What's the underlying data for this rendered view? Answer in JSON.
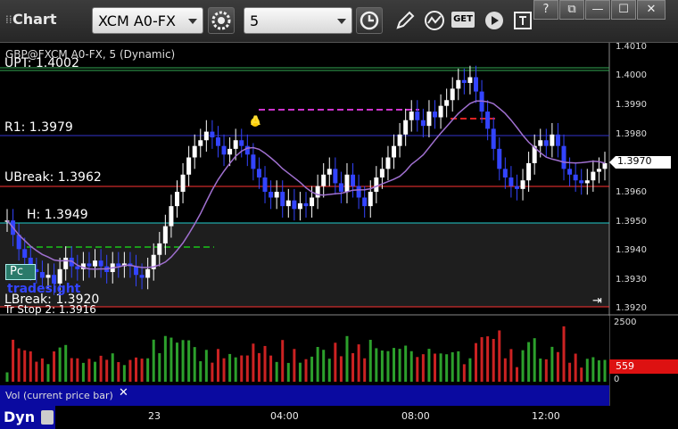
{
  "window": {
    "title": "Chart",
    "controls": [
      "?",
      "⧉",
      "—",
      "☐",
      "✕"
    ]
  },
  "toolbar": {
    "symbol": "XCM A0-FX",
    "interval": "5",
    "get_label": "GET"
  },
  "chart": {
    "instrument_label": "GBP@FXCM A0-FX, 5 (Dynamic)",
    "current_price": "1.3970",
    "current_volume": "559",
    "levels": {
      "upt": "UPT: 1.4002",
      "r1": "R1: 1.3979",
      "ubreak": "UBreak: 1.3962",
      "pivot": "H: 1.3949",
      "lbreak": "LBreak: 1.3920",
      "tr_stop": "Tr Stop 2: 1.3916"
    },
    "price_ticks": [
      "1.4010",
      "1.4000",
      "1.3990",
      "1.3980",
      "1.3960",
      "1.3950",
      "1.3940",
      "1.3930",
      "1.3920"
    ],
    "volume_ticks": [
      "2500",
      "0"
    ],
    "time_ticks": [
      "23",
      "04:00",
      "08:00",
      "12:00"
    ],
    "volume_panel_label": "Vol (current price bar)",
    "close_x": "✕",
    "dyn_label": "Dyn",
    "pc_badge": "Pc",
    "watermark": "tradesight",
    "marker_a": "A",
    "colors": {
      "up_bar": "#ffffff",
      "down_bar": "#3344ff",
      "upt_line": "#33aa55",
      "r1_line": "#3333cc",
      "ubreak_line": "#ff3333",
      "pivot_line": "#22cccc",
      "lbreak_line": "#ff3333",
      "ma_line": "#a070d0",
      "vol_up": "#2ca02c",
      "vol_down": "#cc2222",
      "last_price_bg": "#ffffff"
    }
  },
  "chart_data": {
    "type": "candlestick",
    "ylim": [
      1.3918,
      1.4012
    ],
    "x": [
      "23",
      "04:00",
      "08:00",
      "12:00"
    ],
    "close": [
      1.395,
      1.3945,
      1.394,
      1.3937,
      1.3933,
      1.3932,
      1.393,
      1.3931,
      1.3928,
      1.3933,
      1.3937,
      1.3934,
      1.3933,
      1.3935,
      1.3934,
      1.3936,
      1.3934,
      1.3932,
      1.3935,
      1.3934,
      1.3935,
      1.3934,
      1.3931,
      1.393,
      1.3933,
      1.3938,
      1.3942,
      1.3948,
      1.3955,
      1.396,
      1.3966,
      1.3972,
      1.3976,
      1.3978,
      1.3981,
      1.3979,
      1.3976,
      1.3973,
      1.3975,
      1.3978,
      1.3976,
      1.3973,
      1.3968,
      1.3965,
      1.396,
      1.3958,
      1.396,
      1.3955,
      1.3957,
      1.3954,
      1.3956,
      1.3955,
      1.3958,
      1.3962,
      1.3966,
      1.3968,
      1.3963,
      1.396,
      1.3966,
      1.3962,
      1.3958,
      1.3955,
      1.396,
      1.3965,
      1.3968,
      1.3972,
      1.3976,
      1.398,
      1.3985,
      1.3988,
      1.3985,
      1.3983,
      1.3988,
      1.3986,
      1.399,
      1.3992,
      1.3996,
      1.3999,
      1.3998,
      1.4,
      1.3995,
      1.3988,
      1.3982,
      1.3975,
      1.3968,
      1.3965,
      1.3962,
      1.3961,
      1.3964,
      1.397,
      1.3976,
      1.3978,
      1.3976,
      1.398,
      1.3976,
      1.3968,
      1.3966,
      1.3964,
      1.3963,
      1.3964,
      1.3967,
      1.3968,
      1.397
    ],
    "volume_max": 2500,
    "last_volume": 559
  }
}
